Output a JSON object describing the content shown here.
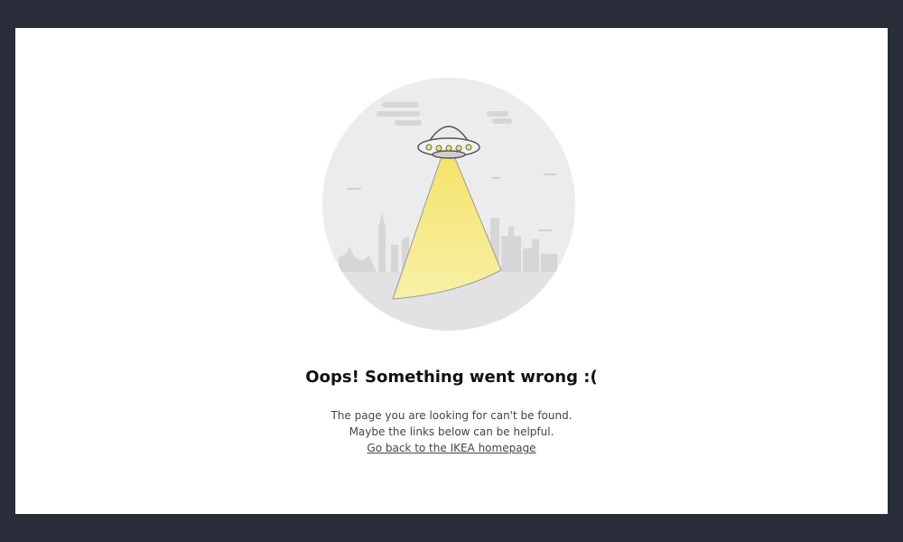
{
  "error": {
    "heading": "Oops! Something went wrong :(",
    "line1": "The page you are looking for can't be found.",
    "line2": "Maybe the links below can be helpful.",
    "home_link": "Go back to the IKEA homepage"
  },
  "illustration": {
    "icon": "ufo-icon"
  },
  "colors": {
    "background": "#282d39",
    "page": "#ffffff",
    "circle": "#ececee",
    "beam": "#f7ea82",
    "city": "#d6d6d8"
  }
}
